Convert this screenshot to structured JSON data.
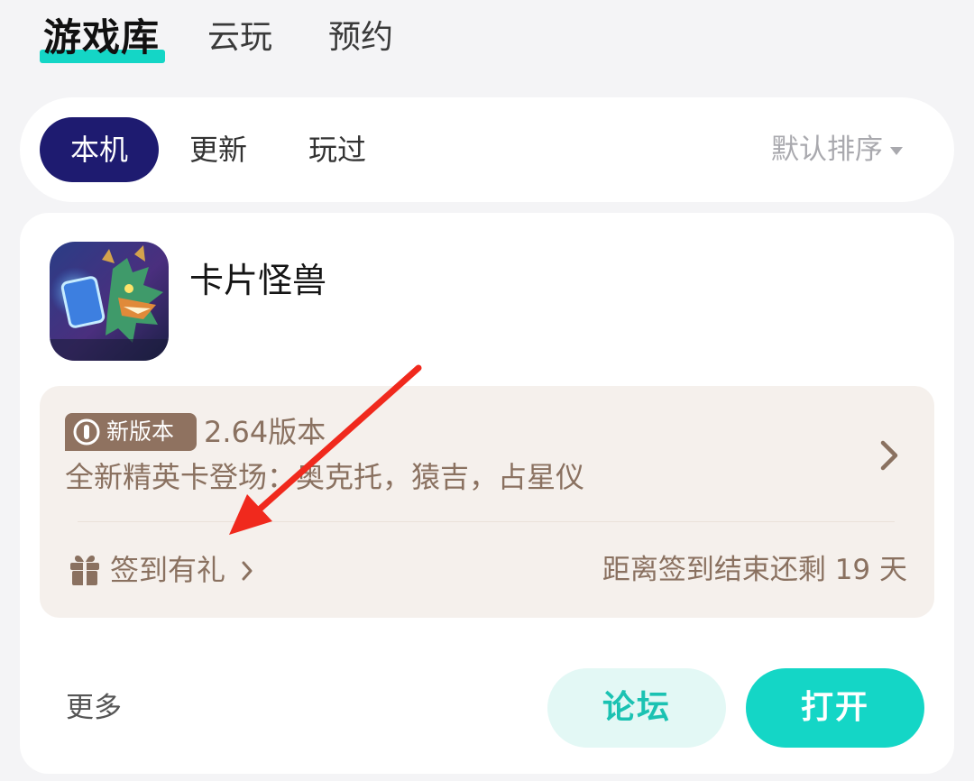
{
  "top_tabs": {
    "library": "游戏库",
    "cloud": "云玩",
    "reserve": "预约"
  },
  "filters": {
    "local": "本机",
    "updates": "更新",
    "played": "玩过",
    "sort": "默认排序"
  },
  "game": {
    "title": "卡片怪兽",
    "news": {
      "badge": "新版本",
      "version": "2.64版本",
      "description": "全新精英卡登场：奥克托，猿吉，占星仪"
    },
    "checkin": {
      "label": "签到有礼",
      "countdown": "距离签到结束还剩 19 天"
    },
    "actions": {
      "more": "更多",
      "forum": "论坛",
      "open": "打开"
    }
  },
  "colors": {
    "accent": "#14d6c6",
    "active_chip": "#1e1b70",
    "news_text": "#8a7160",
    "annotation_arrow": "#f0291d"
  }
}
